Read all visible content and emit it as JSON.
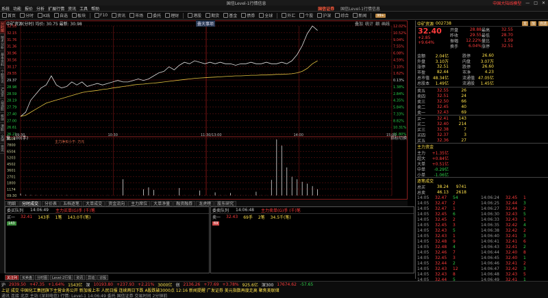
{
  "window": {
    "title": "国信Level-1行情信息",
    "user_label": "中国大陆线模型",
    "controls": [
      "—",
      "□",
      "✕"
    ]
  },
  "menu": {
    "items": [
      "系统",
      "功能",
      "报价",
      "分析",
      "扩展行情",
      "资讯",
      "工具",
      "帮助"
    ],
    "brand": "国信证券",
    "source": "国信Level-1行情信息"
  },
  "toolbar": {
    "items": [
      "首页",
      "分时",
      "K线",
      "自选",
      "板块",
      "F10",
      "资讯",
      "市场",
      "委托",
      "理财",
      "港股",
      "期货",
      "基金",
      "债券",
      "全球",
      "外汇",
      "个股",
      "沪深",
      "综合",
      "新闻"
    ],
    "badge": "99+"
  },
  "sidebar": {
    "tabs": [
      "分时图",
      "技术分析",
      "基本资料",
      "个股资讯",
      "沪深京",
      "自选股",
      "板块",
      "港股",
      "全球",
      "资讯"
    ]
  },
  "chart": {
    "header": "中矿资源(分时) 均价: 30.75 最新: 30.98",
    "top_tabs": [
      "叠加",
      "统计",
      "细",
      "画线"
    ],
    "flag": "叠大事项",
    "vol_header": "量: 100(手)",
    "vol_right": "指标切换",
    "note": "主力净买小于: 万元",
    "colors": {
      "price": "#e0e0e0",
      "avg": "#e6c440",
      "vol": "#e0e0e0",
      "grid": "#7a1414",
      "up": "#ff3c3c",
      "down": "#2fd24a"
    }
  },
  "chart_data": {
    "type": "line",
    "price_ticks_left": [
      "32.55",
      "32.15",
      "31.76",
      "31.36",
      "30.96",
      "30.56",
      "30.17",
      "29.55",
      "29.37",
      "28.98",
      "28.59",
      "28.19",
      "27.79",
      "27.40",
      "27.00",
      "26.61",
      "26.21"
    ],
    "pct_ticks_right": [
      "12.02%",
      "10.52%",
      "9.04%",
      "7.55%",
      "6.08%",
      "4.59%",
      "3.10%",
      "1.62%",
      "0.13%",
      "1.38%",
      "2.84%",
      "4.35%",
      "5.84%",
      "7.33%",
      "8.82%",
      "10.31%",
      "11.80%"
    ],
    "vol_ticks_left": [
      "9105",
      "7800",
      "6504",
      "5203",
      "4502",
      "3601",
      "2701",
      "1800",
      "1174",
      "09:30"
    ],
    "time_labels": [
      "09:30",
      "10:30",
      "11:30/13:00",
      "14:00",
      "15:00"
    ],
    "series": [
      {
        "name": "price",
        "values": [
          29.56,
          29.7,
          30.1,
          30.3,
          30.5,
          30.6,
          30.9,
          30.6,
          30.5,
          30.55,
          30.7,
          30.6,
          30.7,
          30.55,
          30.6,
          30.65,
          30.6,
          30.65,
          30.7,
          30.75,
          30.7,
          30.7,
          30.75,
          30.8,
          30.75,
          30.8,
          30.9,
          31.0,
          31.05,
          31.2,
          31.1,
          31.25,
          31.35,
          31.3,
          31.4,
          31.35,
          31.3,
          31.35,
          31.3,
          31.35,
          31.3,
          31.3,
          31.25,
          31.3,
          31.3,
          31.35,
          31.3,
          31.3,
          31.35,
          31.3,
          31.3,
          31.35,
          31.3,
          31.4,
          31.6,
          31.9,
          32.3,
          32.55,
          32.4
        ]
      },
      {
        "name": "avg",
        "values": [
          29.56,
          29.6,
          29.7,
          29.8,
          29.9,
          30.0,
          30.05,
          30.1,
          30.15,
          30.2,
          30.25,
          30.3,
          30.35,
          30.38,
          30.4,
          30.42,
          30.45,
          30.47,
          30.5,
          30.52,
          30.55,
          30.57,
          30.6,
          30.62,
          30.63,
          30.65,
          30.66,
          30.68,
          30.7,
          30.72,
          30.74,
          30.76,
          30.78,
          30.8,
          30.82,
          30.83,
          30.84,
          30.85,
          30.86,
          30.87,
          30.88,
          30.89,
          30.9,
          30.9,
          30.91,
          30.92,
          30.92,
          30.93,
          30.93,
          30.94,
          30.95,
          30.95,
          30.96,
          30.97,
          31.0,
          31.05,
          31.15,
          31.3,
          31.4
        ]
      }
    ],
    "volume": [
      300,
      120,
      80,
      60,
      50,
      40,
      30,
      40,
      35,
      60,
      30,
      25,
      20,
      30,
      25,
      20,
      15,
      30,
      20,
      15,
      2600,
      15,
      30,
      20,
      1000,
      1300,
      900,
      30,
      20,
      30,
      25,
      1200,
      30,
      20,
      30,
      800,
      25,
      20,
      500,
      40,
      30,
      400,
      30,
      25,
      30,
      20,
      600,
      30,
      20,
      2500,
      9000,
      8000,
      4500,
      3000,
      2600,
      2200,
      1900,
      1500,
      1000
    ],
    "ylim": [
      28.98,
      32.55
    ],
    "xlabel": "",
    "ylabel": ""
  },
  "subtabs": [
    "明细",
    "分时成交",
    "分价表",
    "五档逐笔",
    "大单成交",
    "资金流向",
    "主力席位",
    "大单净量",
    "融资融券",
    "龙虎榜",
    "股东研究"
  ],
  "left_panel": {
    "head_cols": [
      "委买队列",
      "14:06:49"
    ],
    "note": "主力买单(G)手 (千)笔",
    "row": {
      "label": "买一",
      "price": "32.41",
      "vol": "143手",
      "cnt": "1笔",
      "amount": "143.0千(笔)"
    },
    "cell": "143"
  },
  "mid_panel": {
    "head_cols": [
      "委卖队列",
      "14:06:48"
    ],
    "note": "主力卖单(G)手 (千)笔",
    "row": {
      "label": "卖一",
      "price": "32.43",
      "vol": "69手",
      "cnt": "2笔",
      "amount": "34.5千(笔)"
    },
    "cell": "69"
  },
  "right": {
    "stock_name": "中矿资源",
    "code": "002738",
    "header_tags": [
      "龙",
      "加",
      "自选"
    ],
    "price": "32.40",
    "change": "+2.85",
    "change_pct": "+9.64%",
    "summary": [
      [
        "开盘",
        "28.88",
        "最高",
        "32.55"
      ],
      [
        "昨收",
        "29.55",
        "最低",
        "28.70"
      ],
      [
        "振幅",
        "12.22%",
        "量比",
        "1.59"
      ],
      [
        "换手",
        "6.04%",
        "涨停",
        "32.51"
      ],
      [
        "金额",
        "2.04亿",
        "跌停",
        "26.60"
      ],
      [
        "外盘",
        "3.10万",
        "内盘",
        "3.07万"
      ],
      [
        "涨停",
        "32.51",
        "跌停",
        "26.60"
      ],
      [
        "市盈",
        "82.44",
        "市净",
        "4.23"
      ],
      [
        "总市值",
        "48.34亿",
        "流通值",
        "47.05亿"
      ],
      [
        "总股本",
        "1.49亿",
        "流通股",
        "1.45亿"
      ]
    ],
    "ask": [
      [
        "卖五",
        "32.55",
        "26"
      ],
      [
        "卖四",
        "32.51",
        "24"
      ],
      [
        "卖三",
        "32.50",
        "66"
      ],
      [
        "卖二",
        "32.45",
        "40"
      ],
      [
        "卖一",
        "32.43",
        "69"
      ]
    ],
    "bid": [
      [
        "买一",
        "32.41",
        "143"
      ],
      [
        "买二",
        "32.40",
        "214"
      ],
      [
        "买三",
        "32.38",
        "7"
      ],
      [
        "买四",
        "32.37",
        "3"
      ],
      [
        "买五",
        "32.36",
        "27"
      ]
    ],
    "flow_title": "主力资金",
    "flow_items": [
      [
        "主力",
        "+1.35亿"
      ],
      [
        "超大",
        "+0.84亿"
      ],
      [
        "大单",
        "+0.51亿"
      ],
      [
        "中单",
        "-0.29亿"
      ],
      [
        "小单",
        "-1.06亿"
      ]
    ],
    "trade_title": "逐笔成交",
    "trade_total": [
      [
        "总买",
        "38.24",
        "9741"
      ],
      [
        "总卖",
        "46.13",
        "2618"
      ]
    ],
    "trades": [
      [
        "14:05",
        "32.47",
        "54"
      ],
      [
        "14:05",
        "32.47",
        "2"
      ],
      [
        "14:05",
        "32.47",
        "1"
      ],
      [
        "14:05",
        "32.45",
        "6"
      ],
      [
        "14:05",
        "32.45",
        "2"
      ],
      [
        "14:05",
        "32.45",
        "3"
      ],
      [
        "14:05",
        "32.43",
        "5"
      ],
      [
        "14:05",
        "32.43",
        "1"
      ],
      [
        "14:05",
        "32.48",
        "9"
      ],
      [
        "14:05",
        "32.48",
        "4"
      ],
      [
        "14:05",
        "32.46",
        "7"
      ],
      [
        "14:05",
        "32.45",
        "3"
      ],
      [
        "14:05",
        "32.44",
        "2"
      ],
      [
        "14:05",
        "32.43",
        "12"
      ],
      [
        "14:05",
        "32.43",
        "8"
      ],
      [
        "14:05",
        "32.44",
        "5"
      ]
    ],
    "trades2": [
      [
        "14:06:24",
        "32.45",
        "1"
      ],
      [
        "14:06:25",
        "32.44",
        "3"
      ],
      [
        "14:06:27",
        "32.44",
        "2"
      ],
      [
        "14:06:30",
        "32.43",
        "5"
      ],
      [
        "14:06:33",
        "32.43",
        "1"
      ],
      [
        "14:06:35",
        "32.42",
        "4"
      ],
      [
        "14:06:38",
        "32.42",
        "2"
      ],
      [
        "14:06:40",
        "32.41",
        "3"
      ],
      [
        "14:06:41",
        "32.41",
        "6"
      ],
      [
        "14:06:43",
        "32.41",
        "2"
      ],
      [
        "14:06:44",
        "32.40",
        "8"
      ],
      [
        "14:06:45",
        "32.40",
        "1"
      ],
      [
        "14:06:46",
        "32.41",
        "2"
      ],
      [
        "14:06:47",
        "32.42",
        "3"
      ],
      [
        "14:06:48",
        "32.43",
        "5"
      ],
      [
        "14:06:49",
        "32.41",
        "1"
      ]
    ],
    "bottom_tabs": [
      "笔",
      "分",
      "价",
      "设"
    ]
  },
  "bottom_tabs": [
    "关注列",
    "买卖盘",
    "分时图",
    "Level-2行情",
    "资讯",
    "异动",
    "诊股"
  ],
  "status": {
    "row1": [
      {
        "t": "沪",
        "c": "white"
      },
      {
        "t": "2939.50",
        "c": "red"
      },
      {
        "t": "+47.35",
        "c": "red"
      },
      {
        "t": "+1.64%",
        "c": "red"
      },
      {
        "t": "1543亿",
        "c": "yellow"
      },
      {
        "t": "深",
        "c": "white"
      },
      {
        "t": "10193.80",
        "c": "red"
      },
      {
        "t": "+237.93",
        "c": "red"
      },
      {
        "t": "+2.21%",
        "c": "red"
      },
      {
        "t": "3000亿",
        "c": "yellow"
      },
      {
        "t": "创",
        "c": "white"
      },
      {
        "t": "2136.26",
        "c": "red"
      },
      {
        "t": "+77.69",
        "c": "red"
      },
      {
        "t": "+3.78%",
        "c": "red"
      },
      {
        "t": "925.6亿",
        "c": "yellow"
      },
      {
        "t": "深300",
        "c": "white"
      },
      {
        "t": "17674.62",
        "c": "red"
      },
      {
        "t": "-57.65",
        "c": "green"
      }
    ],
    "row2": "上证 成交 中国化工集团旗下主营业务公开 新加坡上市 人民日报 连续两日下跌 A股跌破3000点 12:16 新闻提醒 广发证券 美元指数再度走高 聚焦美联储",
    "row3": "通讯 连接 北京 主站 (深圳电信) 行情: Level-1 14:06:49 委托 国信证券 交易时间 2分钟前"
  }
}
